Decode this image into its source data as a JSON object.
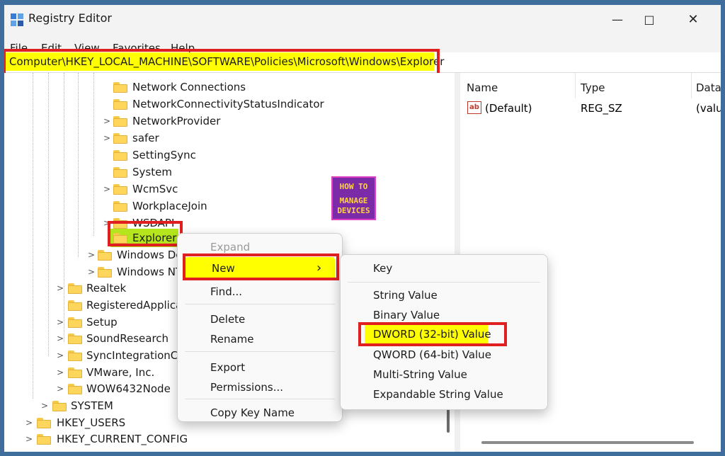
{
  "window": {
    "title": "Registry Editor",
    "icons": {
      "app": "registry-editor-icon",
      "minimize": "minimize-icon",
      "maximize": "maximize-icon",
      "close": "close-icon"
    }
  },
  "menu": [
    "File",
    "Edit",
    "View",
    "Favorites",
    "Help"
  ],
  "address": "Computer\\HKEY_LOCAL_MACHINE\\SOFTWARE\\Policies\\Microsoft\\Windows\\Explorer",
  "tree": {
    "items": [
      {
        "label": "Network Connections",
        "expander": ""
      },
      {
        "label": "NetworkConnectivityStatusIndicator",
        "expander": ""
      },
      {
        "label": "NetworkProvider",
        "expander": ">"
      },
      {
        "label": "safer",
        "expander": ">"
      },
      {
        "label": "SettingSync",
        "expander": ""
      },
      {
        "label": "System",
        "expander": ""
      },
      {
        "label": "WcmSvc",
        "expander": ">"
      },
      {
        "label": "WorkplaceJoin",
        "expander": ""
      },
      {
        "label": "WSDAPI",
        "expander": ">"
      },
      {
        "label": "Explorer",
        "expander": "",
        "selected": true
      },
      {
        "label": "Windows De",
        "expander": ">"
      },
      {
        "label": "Windows NT",
        "expander": ">"
      },
      {
        "label": "Realtek",
        "expander": ">"
      },
      {
        "label": "RegisteredApplica",
        "expander": ""
      },
      {
        "label": "Setup",
        "expander": ">"
      },
      {
        "label": "SoundResearch",
        "expander": ">"
      },
      {
        "label": "SyncIntegrationCli",
        "expander": ">"
      },
      {
        "label": "VMware, Inc.",
        "expander": ">"
      },
      {
        "label": "WOW6432Node",
        "expander": ">"
      },
      {
        "label": "SYSTEM",
        "expander": ">"
      },
      {
        "label": "HKEY_USERS",
        "expander": ">"
      },
      {
        "label": "HKEY_CURRENT_CONFIG",
        "expander": ">"
      }
    ]
  },
  "values_pane": {
    "columns": [
      "Name",
      "Type",
      "Data"
    ],
    "rows": [
      {
        "name": "(Default)",
        "type": "REG_SZ",
        "data": "(valu",
        "icon": "ab"
      }
    ]
  },
  "context_menu": {
    "items": [
      "Expand",
      "New",
      "Find...",
      "Delete",
      "Rename",
      "Export",
      "Permissions...",
      "Copy Key Name"
    ],
    "submenu_arrow": "›"
  },
  "submenu": {
    "items": [
      "Key",
      "String Value",
      "Binary Value",
      "DWORD (32-bit) Value",
      "QWORD (64-bit) Value",
      "Multi-String Value",
      "Expandable String Value"
    ]
  },
  "watermark": {
    "line1": "HOW TO",
    "line2": "MANAGE",
    "line3": "DEVICES"
  },
  "colors": {
    "highlight": "#ffff00",
    "annotation": "#e02020",
    "watermark_bg": "#7b2aa8"
  }
}
